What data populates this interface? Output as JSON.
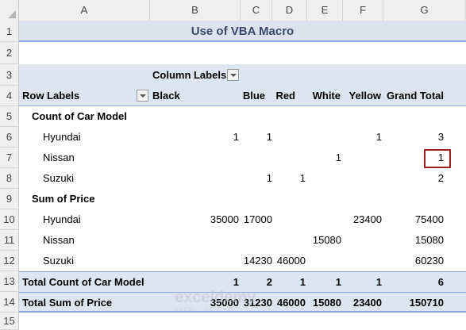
{
  "columns": [
    "A",
    "B",
    "C",
    "D",
    "E",
    "F",
    "G"
  ],
  "rows": [
    "1",
    "2",
    "3",
    "4",
    "5",
    "6",
    "7",
    "8",
    "9",
    "10",
    "11",
    "12",
    "13",
    "14",
    "15"
  ],
  "title": "Use of VBA Macro",
  "pivot": {
    "column_labels": "Column Labels",
    "row_labels": "Row Labels",
    "headers": [
      "Black",
      "Blue",
      "Red",
      "White",
      "Yellow",
      "Grand Total"
    ],
    "count_group": "Count of Car Model",
    "sum_group": "Sum of Price",
    "count_rows": [
      {
        "label": "Hyundai",
        "black": "1",
        "blue": "1",
        "red": "",
        "white": "",
        "yellow": "1",
        "total": "3"
      },
      {
        "label": "Nissan",
        "black": "",
        "blue": "",
        "red": "",
        "white": "1",
        "yellow": "",
        "total": "1"
      },
      {
        "label": "Suzuki",
        "black": "",
        "blue": "1",
        "red": "1",
        "white": "",
        "yellow": "",
        "total": "2"
      }
    ],
    "sum_rows": [
      {
        "label": "Hyundai",
        "black": "35000",
        "blue": "17000",
        "red": "",
        "white": "",
        "yellow": "23400",
        "total": "75400"
      },
      {
        "label": "Nissan",
        "black": "",
        "blue": "",
        "red": "",
        "white": "15080",
        "yellow": "",
        "total": "15080"
      },
      {
        "label": "Suzuki",
        "black": "",
        "blue": "14230",
        "red": "46000",
        "white": "",
        "yellow": "",
        "total": "60230"
      }
    ],
    "total_count": {
      "label": "Total Count of Car Model",
      "black": "1",
      "blue": "2",
      "red": "1",
      "white": "1",
      "yellow": "1",
      "total": "6"
    },
    "total_sum": {
      "label": "Total Sum of Price",
      "black": "35000",
      "blue": "31230",
      "red": "46000",
      "white": "15080",
      "yellow": "23400",
      "total": "150710"
    }
  },
  "watermark": {
    "name": "exceldemy",
    "tagline": "EXCEL · DATA · BI"
  }
}
